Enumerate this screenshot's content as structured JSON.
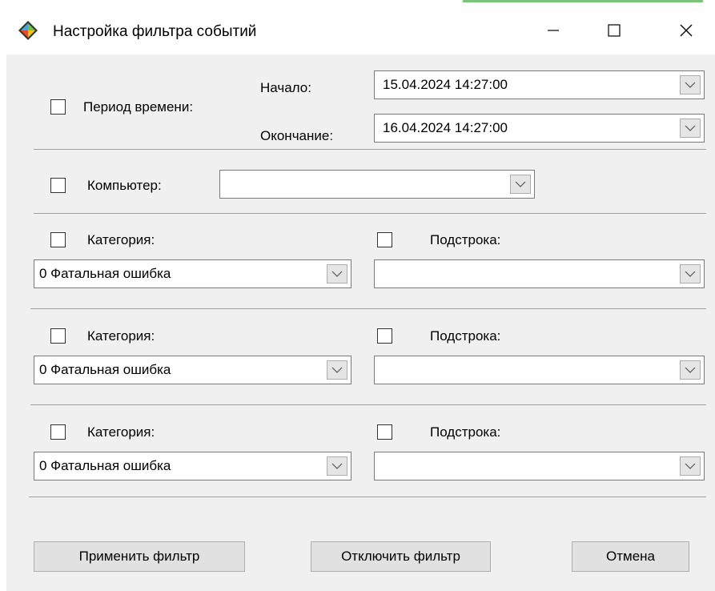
{
  "window": {
    "title": "Настройка фильтра событий",
    "minimize": "–",
    "maximize": "☐",
    "close": "✕"
  },
  "period": {
    "checkbox_label": "Период времени:",
    "start_label": "Начало:",
    "start_value": "15.04.2024 14:27:00",
    "end_label": "Окончание:",
    "end_value": "16.04.2024 14:27:00",
    "checked": false
  },
  "computer": {
    "checkbox_label": "Компьютер:",
    "value": "",
    "checked": false
  },
  "filters": [
    {
      "category_label": "Категория:",
      "category_value": "0  Фатальная ошибка",
      "substring_label": "Подстрока:",
      "substring_value": ""
    },
    {
      "category_label": "Категория:",
      "category_value": "0  Фатальная ошибка",
      "substring_label": "Подстрока:",
      "substring_value": ""
    },
    {
      "category_label": "Категория:",
      "category_value": "0  Фатальная ошибка",
      "substring_label": "Подстрока:",
      "substring_value": ""
    }
  ],
  "buttons": {
    "apply": "Применить фильтр",
    "disable": "Отключить фильтр",
    "cancel": "Отмена"
  },
  "icons": {
    "app": "diamond-app-icon",
    "dropdown": "chevron-down-icon"
  }
}
